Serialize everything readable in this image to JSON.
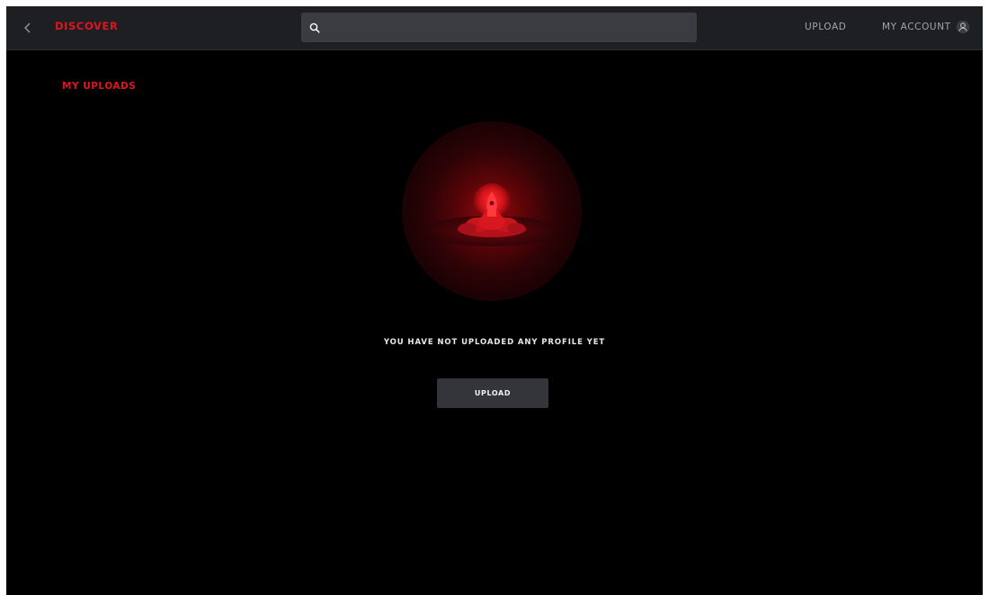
{
  "header": {
    "brand_label": "DISCOVER",
    "search": {
      "value": "",
      "placeholder": ""
    },
    "nav": {
      "upload_label": "UPLOAD",
      "account_label": "MY ACCOUNT"
    },
    "icons": {
      "back": "chevron-left-icon",
      "search": "search-icon",
      "account": "user-icon"
    }
  },
  "main": {
    "section_title": "MY UPLOADS",
    "empty_state": {
      "message": "YOU HAVE NOT UPLOADED ANY PROFILE YET",
      "button_label": "UPLOAD",
      "illustration": "rocket-launch-illustration"
    }
  },
  "colors": {
    "accent": "#e0141e",
    "background": "#000000",
    "topbar": "#1e1f23",
    "search_bg": "#3b3c41",
    "button_bg": "#33353b",
    "nav_text": "#a3a4a8"
  }
}
